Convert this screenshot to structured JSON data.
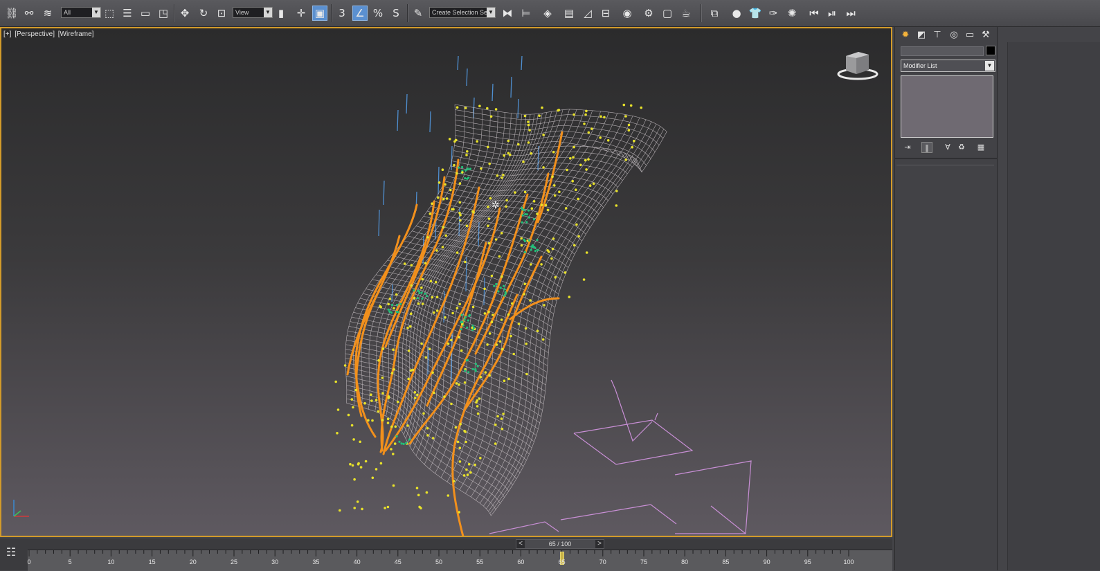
{
  "toolbar": {
    "selection_filter": "All",
    "reference_coordinate": "View",
    "named_selection_set": "Create Selection Se",
    "angle_snap_label": "3",
    "percent_snap_label": "%",
    "spinner_snap_label": "S",
    "icons": [
      "link-icon",
      "unlink-icon",
      "bind-space-warp-icon",
      "select-object-icon",
      "select-by-name-icon",
      "rectangular-region-icon",
      "window-crossing-icon",
      "move-icon",
      "rotate-icon",
      "scale-icon",
      "select-manipulate-icon",
      "use-pivot-center-icon",
      "snap-toggle-icon",
      "angle-snap-icon",
      "percent-snap-icon",
      "spinner-snap-icon",
      "edit-named-selection-icon",
      "mirror-icon",
      "align-icon",
      "layer-explorer-icon",
      "scene-explorer-icon",
      "curve-editor-icon",
      "schematic-view-icon",
      "material-editor-icon",
      "render-setup-icon",
      "rendered-frame-window-icon",
      "render-production-icon",
      "render-iterative-icon"
    ]
  },
  "viewport": {
    "label_parts": [
      "[+]",
      "[Perspective]",
      "[Wireframe]"
    ],
    "accent_border": "#d39b2a"
  },
  "timeline": {
    "frame_display": "65 / 100",
    "current_frame": 65,
    "total_frames": 100,
    "tick_labels": [
      "0",
      "5",
      "10",
      "15",
      "20",
      "25",
      "30",
      "35",
      "40",
      "45",
      "50",
      "55",
      "60",
      "65",
      "70",
      "75",
      "80",
      "85",
      "90",
      "95",
      "100"
    ],
    "prev_arrow": "<",
    "next_arrow": ">"
  },
  "command_panel": {
    "tabs": [
      "create-tab",
      "modify-tab",
      "hierarchy-tab",
      "motion-tab",
      "display-tab",
      "utilities-tab"
    ],
    "active_tab": "create-tab",
    "object_name": "",
    "object_color": "#000000",
    "modifier_list_label": "Modifier List",
    "stack_buttons": [
      "pin-stack-icon",
      "show-end-result-icon",
      "make-unique-icon",
      "remove-modifier-icon",
      "configure-modifier-sets-icon"
    ]
  },
  "colors": {
    "wireframe": "#c9c2c6",
    "splines": "#f2901c",
    "particles_yellow": "#e8e22a",
    "particles_green": "#22c07a",
    "rain_blue": "#4f8fd0",
    "helpers_pink": "#c98fd6"
  }
}
